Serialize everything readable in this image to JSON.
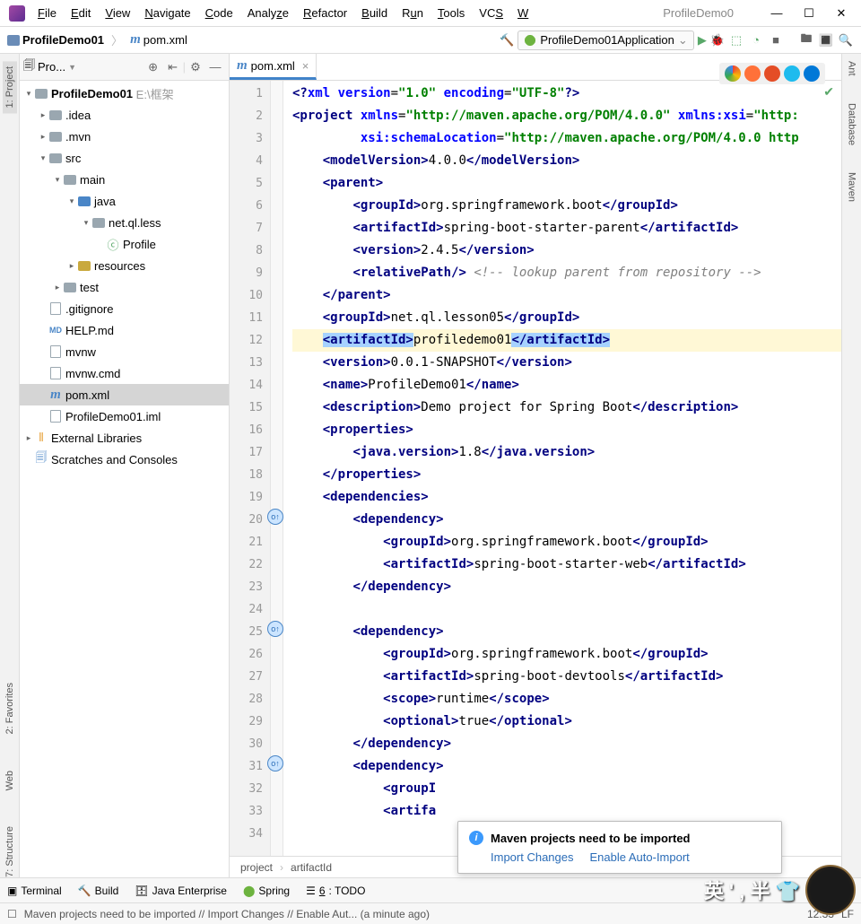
{
  "menubar": {
    "items": [
      "File",
      "Edit",
      "View",
      "Navigate",
      "Code",
      "Analyze",
      "Refactor",
      "Build",
      "Run",
      "Tools",
      "VCS",
      "W"
    ],
    "project": "ProfileDemo0"
  },
  "toolbar": {
    "breadcrumb": {
      "root": "ProfileDemo01",
      "file": "pom.xml"
    },
    "run_config": "ProfileDemo01Application"
  },
  "project_pane": {
    "title": "Pro...",
    "tree": {
      "root": "ProfileDemo01",
      "root_path": "E:\\框架",
      "idea": ".idea",
      "mvn": ".mvn",
      "src": "src",
      "main": "main",
      "java": "java",
      "pkg": "net.ql.less",
      "cls": "Profile",
      "resources": "resources",
      "test": "test",
      "gitignore": ".gitignore",
      "help": "HELP.md",
      "mvnw": "mvnw",
      "mvnwcmd": "mvnw.cmd",
      "pom": "pom.xml",
      "iml": "ProfileDemo01.iml",
      "ext": "External Libraries",
      "scratch": "Scratches and Consoles"
    }
  },
  "tab": {
    "label": "pom.xml"
  },
  "editor": {
    "lines": [
      1,
      2,
      3,
      4,
      5,
      6,
      7,
      8,
      9,
      10,
      11,
      12,
      13,
      14,
      15,
      16,
      17,
      18,
      19,
      20,
      21,
      22,
      23,
      24,
      25,
      26,
      27,
      28,
      29,
      30,
      31,
      32,
      33,
      34
    ],
    "breadcrumb": [
      "project",
      "artifactId"
    ],
    "pom": {
      "xml_decl_version": "1.0",
      "xml_decl_encoding": "UTF-8",
      "xmlns": "http://maven.apache.org/POM/4.0.0",
      "schema": "http://maven.apache.org/POM/4.0.0 http",
      "modelVersion": "4.0.0",
      "parent_group": "org.springframework.boot",
      "parent_artifact": "spring-boot-starter-parent",
      "parent_version": "2.4.5",
      "parent_comment": "<!-- lookup parent from repository -->",
      "group": "net.ql.lesson05",
      "artifact": "profiledemo01",
      "version": "0.0.1-SNAPSHOT",
      "name": "ProfileDemo01",
      "description": "Demo project for Spring Boot",
      "java_version": "1.8",
      "dep1_group": "org.springframework.boot",
      "dep1_artifact": "spring-boot-starter-web",
      "dep2_group": "org.springframework.boot",
      "dep2_artifact": "spring-boot-devtools",
      "dep2_scope": "runtime",
      "dep2_optional": "true"
    }
  },
  "left_rail": {
    "project": "1: Project",
    "favorites": "2: Favorites",
    "web": "Web",
    "structure": "7: Structure"
  },
  "right_rail": {
    "ant": "Ant",
    "database": "Database",
    "maven": "Maven"
  },
  "bottom_bar": {
    "terminal": "Terminal",
    "build": "Build",
    "javaee": "Java Enterprise",
    "spring": "Spring",
    "todo": "6: TODO"
  },
  "status": {
    "msg": "Maven projects need to be imported // Import Changes // Enable Aut... (a minute ago)",
    "time": "12:33",
    "lf": "LF"
  },
  "popup": {
    "title": "Maven projects need to be imported",
    "link1": "Import Changes",
    "link2": "Enable Auto-Import"
  },
  "watermark": "英 ' , 半 👕"
}
